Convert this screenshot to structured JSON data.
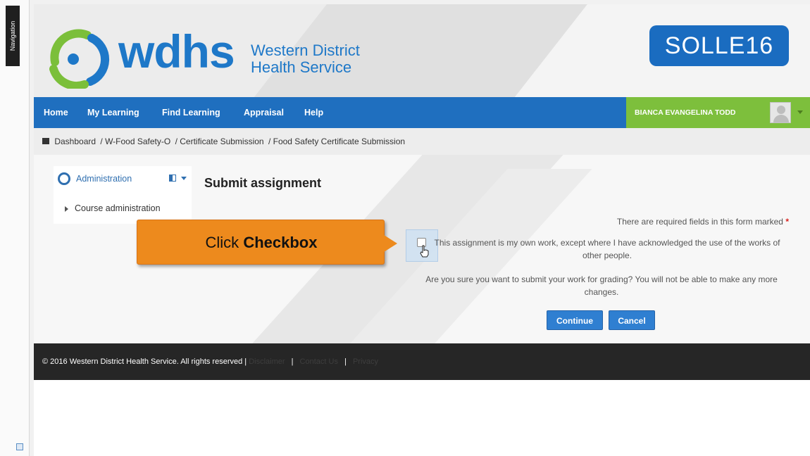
{
  "side_nav": {
    "label": "Navigation"
  },
  "header": {
    "logo_word": "wdhs",
    "logo_line1": "Western District",
    "logo_line2": "Health Service",
    "course_code": "SOLLE16"
  },
  "topnav": {
    "items": [
      "Home",
      "My Learning",
      "Find Learning",
      "Appraisal",
      "Help"
    ],
    "user_name": "BIANCA EVANGELINA TODD"
  },
  "breadcrumb": [
    "Dashboard",
    "/ W-Food Safety-O",
    "/ Certificate Submission",
    "/ Food Safety Certificate Submission"
  ],
  "admin_block": {
    "title": "Administration",
    "item": "Course administration"
  },
  "main": {
    "title": "Submit assignment",
    "required_note": "There are required fields in this form marked",
    "required_marker": "*",
    "statement": "This assignment is my own work, except where I have acknowledged the use of the works of other people.",
    "confirm": "Are you sure you want to submit your work for grading? You will not be able to make any more changes.",
    "continue_label": "Continue",
    "cancel_label": "Cancel"
  },
  "callout": {
    "prefix": "Click",
    "emphasis": "Checkbox"
  },
  "footer": {
    "copyright": "© 2016 Western District Health Service. All rights reserved |",
    "link1": "Disclaimer",
    "link2": "Contact Us",
    "link3": "Privacy"
  },
  "colors": {
    "brand_blue": "#1f6fbf",
    "user_green": "#7dbf3c",
    "callout_orange": "#ed8a1d",
    "button_blue": "#2f7fd1",
    "footer_dark": "#262626"
  },
  "icons": {
    "home": "home-icon",
    "gear": "gear-icon",
    "dock": "dock-icon",
    "cursor": "hand-cursor-icon"
  }
}
